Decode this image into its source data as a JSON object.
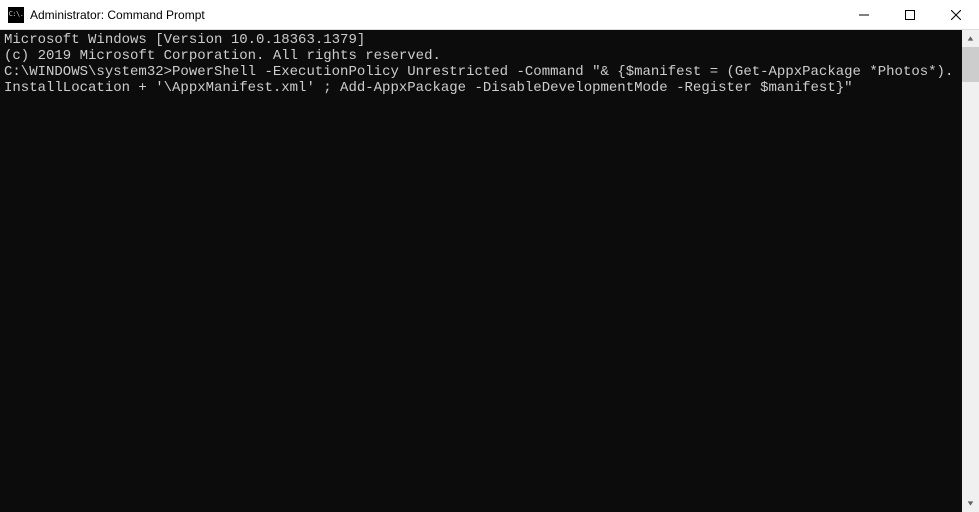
{
  "window": {
    "title": "Administrator: Command Prompt",
    "icon_glyph": "C:\\."
  },
  "terminal": {
    "line1": "Microsoft Windows [Version 10.0.18363.1379]",
    "line2": "(c) 2019 Microsoft Corporation. All rights reserved.",
    "blank": "",
    "prompt_path": "C:\\WINDOWS\\system32>",
    "command": "PowerShell -ExecutionPolicy Unrestricted -Command \"& {$manifest = (Get-AppxPackage *Photos*).InstallLocation + '\\AppxManifest.xml' ; Add-AppxPackage -DisableDevelopmentMode -Register $manifest}\""
  }
}
